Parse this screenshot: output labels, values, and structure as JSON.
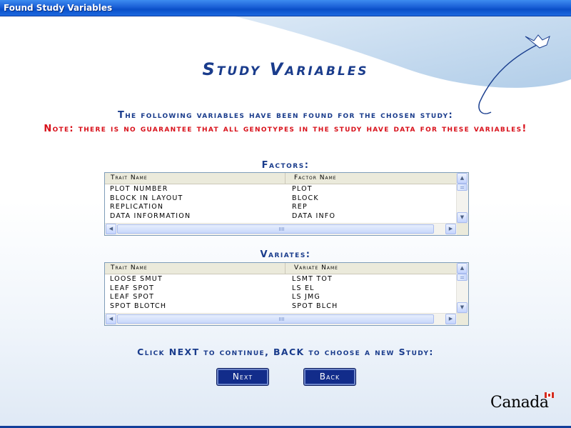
{
  "window": {
    "title": "Found Study Variables"
  },
  "page": {
    "title": "Study Variables",
    "intro": "The following variables have been found for the chosen study:",
    "note": "Note: there is no guarantee that all genotypes in the study have data for these variables!",
    "instruction": "Click NEXT to continue, BACK to choose a new Study:"
  },
  "factors": {
    "heading": "Factors:",
    "columns": [
      "Trait Name",
      "Factor Name"
    ],
    "rows": [
      [
        "PLOT NUMBER",
        "PLOT"
      ],
      [
        "BLOCK IN LAYOUT",
        "BLOCK"
      ],
      [
        "REPLICATION",
        "REP"
      ],
      [
        "DATA INFORMATION",
        "DATA INFO"
      ]
    ]
  },
  "variates": {
    "heading": "Variates:",
    "columns": [
      "Trait Name",
      "Variate Name"
    ],
    "rows": [
      [
        "LOOSE SMUT",
        "LSMT TOT"
      ],
      [
        "LEAF SPOT",
        "LS EL"
      ],
      [
        "LEAF SPOT",
        "LS JMG"
      ],
      [
        "SPOT BLOTCH",
        "SPOT BLCH"
      ]
    ]
  },
  "buttons": {
    "next": "Next",
    "back": "Back"
  },
  "branding": {
    "wordmark": "Canada"
  },
  "colors": {
    "heading": "#1a3c8c",
    "note": "#d8101a",
    "button": "#122c8a",
    "titlebar": "#0a4fc8"
  },
  "icons": [
    "scroll-up-icon",
    "scroll-down-icon",
    "scroll-left-icon",
    "scroll-right-icon",
    "canada-flag-icon"
  ]
}
